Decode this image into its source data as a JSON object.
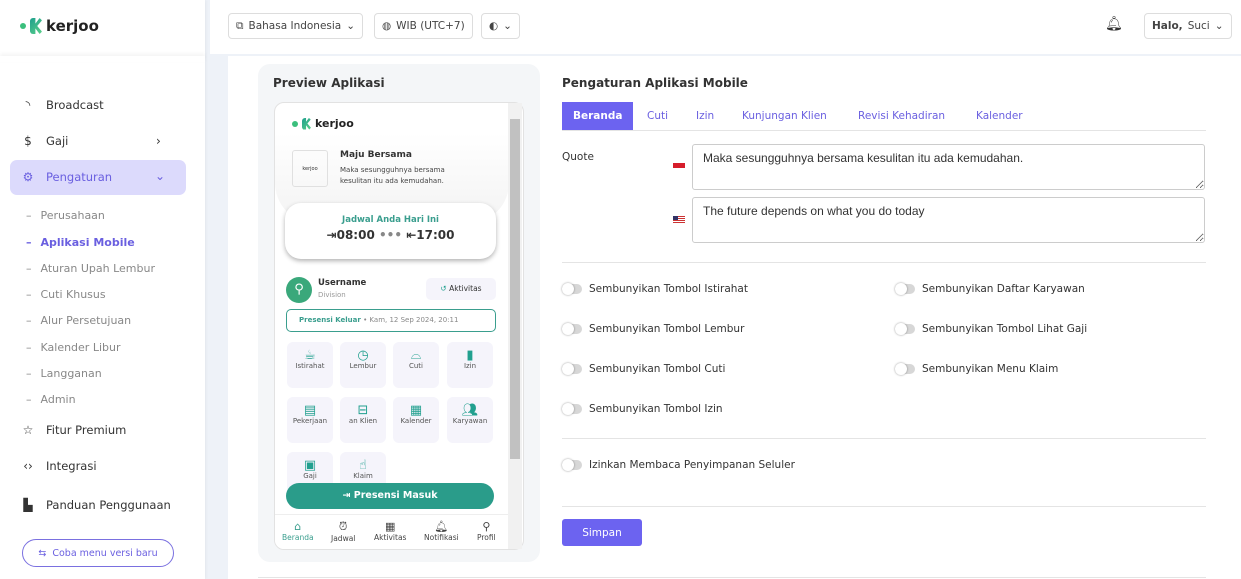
{
  "brand": {
    "name": "kerjoo",
    "accent": "#6c63f0",
    "green": "#22a08f"
  },
  "sidebar": {
    "items": [
      {
        "label": "Broadcast",
        "icon": "rss-icon"
      },
      {
        "label": "Gaji",
        "icon": "dollar-icon"
      },
      {
        "label": "Pengaturan",
        "icon": "gear-icon"
      },
      {
        "label": "Fitur Premium",
        "icon": "star-icon"
      },
      {
        "label": "Integrasi",
        "icon": "code-icon"
      },
      {
        "label": "Panduan Penggunaan",
        "icon": "pdf-icon"
      }
    ],
    "sub": [
      "Perusahaan",
      "Aplikasi Mobile",
      "Aturan Upah Lembur",
      "Cuti Khusus",
      "Alur Persetujuan",
      "Kalender Libur",
      "Langganan",
      "Admin"
    ],
    "try_new": "Coba menu versi baru"
  },
  "topbar": {
    "language": "Bahasa Indonesia",
    "timezone": "WIB (UTC+7)",
    "greeting_bold": "Halo,",
    "user": "Suci"
  },
  "preview": {
    "title": "Preview Aplikasi",
    "company": "Maju Bersama",
    "quote": "Maka sesungguhnya bersama kesulitan itu ada kemudahan.",
    "schedule_title": "Jadwal Anda Hari Ini",
    "time_in": "08:00",
    "time_out": "17:00",
    "username": "Username",
    "division": "Division",
    "activity": "Aktivitas",
    "last_presence_label": "Presensi Keluar",
    "last_presence_time": "• Kam, 12 Sep 2024, 20:11",
    "menu": [
      "Istirahat",
      "Lembur",
      "Cuti",
      "Izin",
      "Pekerjaan",
      "an Klien",
      "Kalender",
      "Karyawan",
      "Gaji",
      "Klaim"
    ],
    "presence_button": "Presensi Masuk",
    "bottom_nav": [
      "Beranda",
      "Jadwal",
      "Aktivitas",
      "Notifikasi",
      "Profil"
    ]
  },
  "settings": {
    "title": "Pengaturan Aplikasi Mobile",
    "tabs": [
      "Beranda",
      "Cuti",
      "Izin",
      "Kunjungan Klien",
      "Revisi Kehadiran",
      "Kalender"
    ],
    "quote_label": "Quote",
    "quote_id": "Maka sesungguhnya bersama kesulitan itu ada kemudahan.",
    "quote_en": "The future depends on what you do today",
    "toggles_left": [
      "Sembunyikan Tombol Istirahat",
      "Sembunyikan Tombol Lembur",
      "Sembunyikan Tombol Cuti",
      "Sembunyikan Tombol Izin"
    ],
    "toggles_right": [
      "Sembunyikan Daftar Karyawan",
      "Sembunyikan Tombol Lihat Gaji",
      "Sembunyikan Menu Klaim"
    ],
    "storage_toggle": "Izinkan Membaca Penyimpanan Seluler",
    "save": "Simpan"
  }
}
